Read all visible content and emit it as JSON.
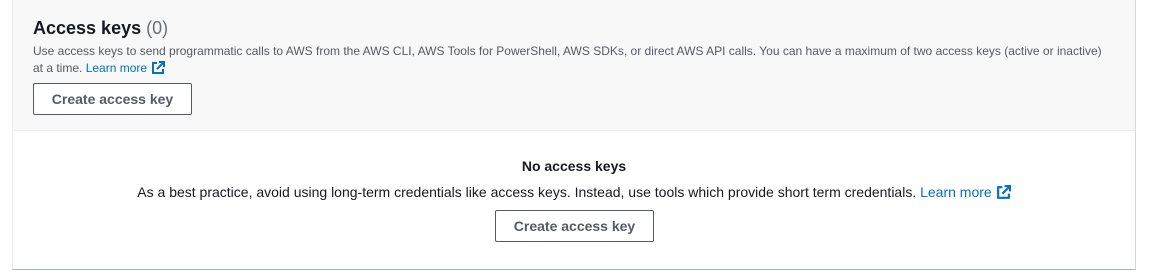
{
  "header": {
    "title": "Access keys",
    "count": "(0)",
    "description": "Use access keys to send programmatic calls to AWS from the AWS CLI, AWS Tools for PowerShell, AWS SDKs, or direct AWS API calls. You can have a maximum of two access keys (active or inactive) at a time.",
    "learn_more": "Learn more",
    "create_button": "Create access key"
  },
  "empty_state": {
    "title": "No access keys",
    "text": "As a best practice, avoid using long-term credentials like access keys. Instead, use tools which provide short term credentials.",
    "learn_more": "Learn more",
    "create_button": "Create access key"
  },
  "icons": {
    "external_link": "external-link-icon"
  },
  "colors": {
    "link": "#0073bb",
    "header_bg": "#f8f8f8",
    "text": "#16191f",
    "muted": "#545b64"
  }
}
